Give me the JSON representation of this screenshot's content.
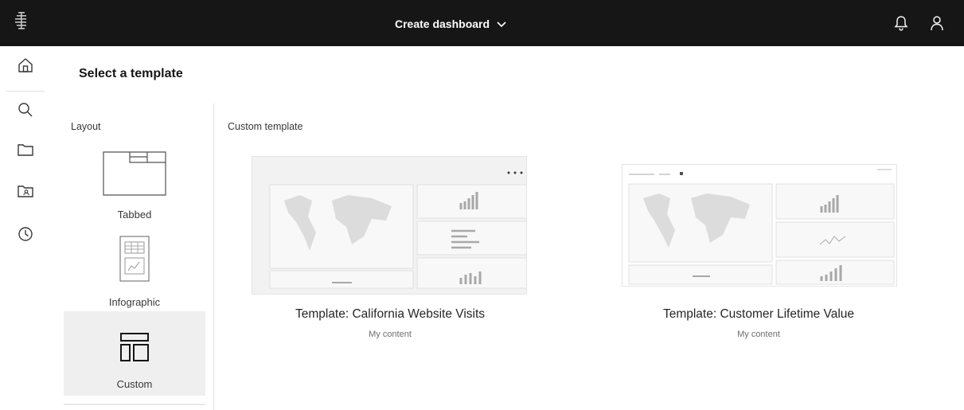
{
  "header": {
    "title": "Create dashboard",
    "icons": [
      "app-menu-icon",
      "chevron-down-icon",
      "notification-bell-icon",
      "user-icon"
    ]
  },
  "sidenav": {
    "items": [
      {
        "name": "home",
        "icon": "home-icon"
      },
      {
        "name": "search",
        "icon": "search-icon"
      },
      {
        "name": "content",
        "icon": "folder-icon"
      },
      {
        "name": "team-content",
        "icon": "team-folder-icon"
      },
      {
        "name": "recent",
        "icon": "clock-icon"
      }
    ]
  },
  "panel": {
    "title": "Select a template"
  },
  "layout": {
    "label": "Layout",
    "items": [
      {
        "label": "Tabbed",
        "icon": "tabbed-layout-icon"
      },
      {
        "label": "Infographic",
        "icon": "infographic-layout-icon"
      },
      {
        "label": "Custom",
        "icon": "custom-layout-icon",
        "selected": true
      }
    ]
  },
  "templates": {
    "label": "Custom template",
    "items": [
      {
        "title": "Template: California Website Visits",
        "subtitle": "My content"
      },
      {
        "title": "Template: Customer Lifetime Value",
        "subtitle": "My content"
      }
    ]
  },
  "colors": {
    "topbar": "#161616",
    "selected_bg": "#efefef",
    "divider": "#e0e0e0"
  }
}
